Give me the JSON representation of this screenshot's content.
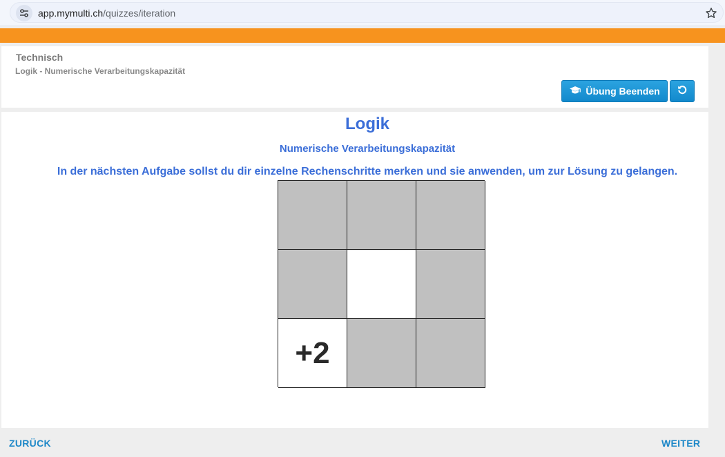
{
  "browser": {
    "url_host": "app.mymulti.ch",
    "url_path": "/quizzes/iteration",
    "site_icon": "tune-icon",
    "bookmark_icon": "star-icon"
  },
  "header": {
    "category": "Technisch",
    "subcategory": "Logik - Numerische Verarbeitungskapazität",
    "end_button": {
      "label": "Übung Beenden",
      "icon": "graduation-cap-icon"
    },
    "reset_button": {
      "icon": "refresh-icon"
    }
  },
  "quiz": {
    "title": "Logik",
    "subtitle": "Numerische Verarbeitungskapazität",
    "instruction": "In der nächsten Aufgabe sollst du dir einzelne Rechenschritte merken und sie anwenden, um zur Lösung zu gelangen.",
    "grid": [
      {
        "state": "grey",
        "text": ""
      },
      {
        "state": "grey",
        "text": ""
      },
      {
        "state": "grey",
        "text": ""
      },
      {
        "state": "grey",
        "text": ""
      },
      {
        "state": "white",
        "text": ""
      },
      {
        "state": "grey",
        "text": ""
      },
      {
        "state": "white",
        "text": "+2"
      },
      {
        "state": "grey",
        "text": ""
      },
      {
        "state": "grey",
        "text": ""
      }
    ]
  },
  "footer": {
    "back_label": "ZURÜCK",
    "next_label": "WEITER"
  },
  "colors": {
    "accent_orange": "#f7931e",
    "title_blue": "#3b6ed8",
    "button_blue": "#1a93d6",
    "cell_grey": "#c0c0c0"
  }
}
